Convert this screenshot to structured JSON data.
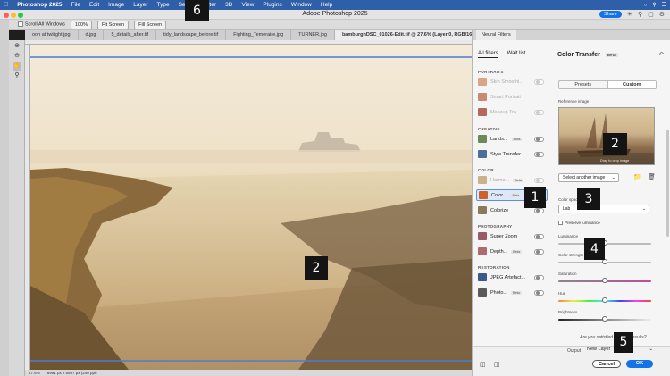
{
  "menubar": {
    "apple": "",
    "app_name": "Photoshop 2025",
    "items": [
      "File",
      "Edit",
      "Image",
      "Layer",
      "Type",
      "Select",
      "Filter",
      "3D",
      "View",
      "Plugins",
      "Window",
      "Help"
    ]
  },
  "window": {
    "title": "Adobe Photoshop 2025",
    "share_label": "Share"
  },
  "options_bar": {
    "scroll_all": "Scroll All Windows",
    "zoom": "100%",
    "fit_screen": "Fit Screen",
    "fill_screen": "Fill Screen"
  },
  "doc_tabs": [
    "oon at twilight.jpg",
    "d.jpg",
    "5_details_after.tif",
    "tidy_landscape_before.tif",
    "Fighting_Temeraire.jpg",
    "TURNER.jpg",
    "bamburghDSC_01026-Edit.tif @ 27.6% (Layer 0, RGB/16*)"
  ],
  "status": {
    "zoom": "27.6%",
    "doc_info": "8991 px x 5987 px (240 ppi)"
  },
  "neural_filters": {
    "panel_tab": "Neural Filters",
    "tab_all": "All filters",
    "tab_wait": "Wait list",
    "beta_label": "Beta",
    "sections": {
      "portraits": "PORTRAITS",
      "creative": "CREATIVE",
      "color": "COLOR",
      "photography": "PHOTOGRAPHY",
      "restoration": "RESTORATION"
    },
    "filters": {
      "skin_smoothing": "Skin Smoothi...",
      "smart_portrait": "Smart Portrait",
      "makeup_transfer": "Makeup Tra...",
      "landscape_mixer": "Lands...",
      "style_transfer": "Style Transfer",
      "harmonization": "Harmo...",
      "color_transfer": "Color...",
      "colorize": "Colorize",
      "super_zoom": "Super Zoom",
      "depth_blur": "Depth...",
      "jpeg_artifacts": "JPEG Artefact...",
      "photo_restoration": "Photo..."
    }
  },
  "color_transfer": {
    "title": "Color Transfer",
    "beta": "Beta",
    "seg_presets": "Presets",
    "seg_custom": "Custom",
    "reference_label": "Reference image",
    "drag_hint": "Drag to crop image",
    "select_another": "Select another image",
    "color_space_label": "Color space",
    "color_space_value": "Lab",
    "preserve_luminance": "Preserve luminance",
    "luminance_label": "Luminance",
    "color_strength_label": "Color strength",
    "saturation_label": "Saturation",
    "hue_label": "Hue",
    "brightness_label": "Brightness",
    "satisfied_question": "Are you satisfied with the results?",
    "output_label": "Output",
    "output_value": "New Layer",
    "cancel_label": "Cancel",
    "ok_label": "OK",
    "sliders": {
      "luminance": 0.5,
      "color_strength": 0.5,
      "saturation": 0.5,
      "hue": 0.5,
      "brightness": 0.5
    }
  },
  "badges": [
    "1",
    "2",
    "2",
    "3",
    "4",
    "5",
    "6"
  ],
  "colors": {
    "menubar": "#2e5fa8",
    "accent": "#1473e6",
    "badge": "#141414"
  }
}
